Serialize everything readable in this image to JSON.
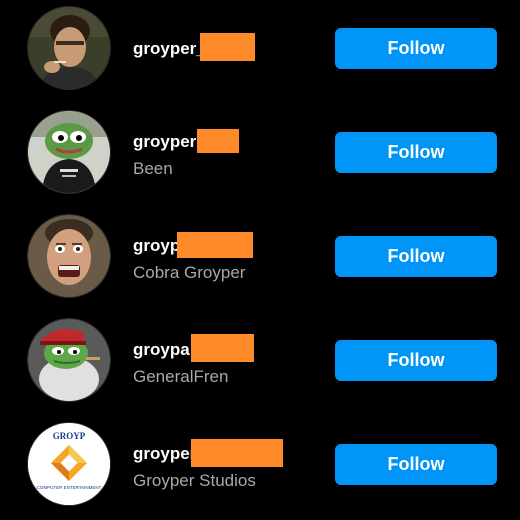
{
  "accounts": [
    {
      "username": "groyper_",
      "full_name": "",
      "button_label": "Follow",
      "avatar_icon": "man-smoking-portrait-icon"
    },
    {
      "username": "groyper",
      "full_name": "Been",
      "button_label": "Follow",
      "avatar_icon": "pepe-frog-portrait-icon"
    },
    {
      "username": "groyp",
      "full_name": "Cobra Groyper",
      "button_label": "Follow",
      "avatar_icon": "shouting-man-portrait-icon"
    },
    {
      "username": "groypa",
      "full_name": "GeneralFren",
      "button_label": "Follow",
      "avatar_icon": "frog-general-portrait-icon"
    },
    {
      "username": "groyper",
      "full_name": "Groyper Studios",
      "button_label": "Follow",
      "avatar_icon": "groyp-logo-icon"
    }
  ],
  "logo": {
    "top_text": "GROYP",
    "bottom_text": "COMPUTER ENTERTAINMENT"
  },
  "colors": {
    "background": "#000000",
    "follow_button": "#0095f6",
    "redaction": "#ff8a2a",
    "secondary_text": "#a8a8a8"
  }
}
